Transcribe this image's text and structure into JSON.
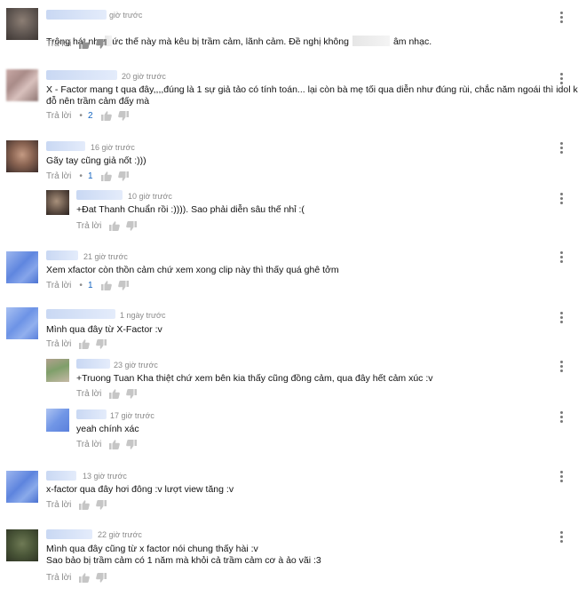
{
  "ui": {
    "reply_label": "Trả lời",
    "dot": "•",
    "like_icon": "thumbs-up-icon",
    "dislike_icon": "thumbs-down-icon",
    "menu_icon": "more-vert-icon"
  },
  "comments": [
    {
      "time": "giờ trước",
      "text_before": "Trông hát như",
      "text_middle": "ức thế này mà kêu bị trầm cảm, lãnh cảm. Đề nghị không",
      "text_after": "âm nhạc."
    },
    {
      "time": "20 giờ trước",
      "text": "X - Factor mang t qua đây,,,,đúng là 1 sự giả tảo có tính toán... lại còn bà mẹ tối qua diễn như đúng rùi, chắc năm ngoái thì idol k\nđỗ nên trầm cảm đấy mà",
      "reply_count": "2"
    },
    {
      "time": "16 giờ trước",
      "text": "Gãy tay cũng giả nốt :)))",
      "reply_count": "1"
    },
    {
      "time": "10 giờ trước",
      "text": "+Đat Thanh Chuẩn rồi :)))). Sao phải diễn sâu thế nhỉ :("
    },
    {
      "time": "21 giờ trước",
      "text": "Xem xfactor còn thồn cảm chứ xem xong clip này thì thấy quá ghê tởm",
      "reply_count": "1"
    },
    {
      "time": "1 ngày trước",
      "text": "Mình qua đây từ X-Factor :v"
    },
    {
      "time": "23 giờ trước",
      "text": "+Truong Tuan Kha thiệt chứ xem bên kia thấy cũng đồng cảm, qua đây hết cảm xúc :v"
    },
    {
      "time": "17 giờ trước",
      "text": "yeah chính xác"
    },
    {
      "time": "13 giờ trước",
      "text": "x-factor qua đây hơi đông :v lượt view tăng :v"
    },
    {
      "time": "22 giờ trước",
      "text": "Mình qua đây cũng từ x factor nói chung thấy hài :v\nSao bảo bị trầm cảm có 1 năm mà khỏi cả trầm cảm cơ à ảo vãi :3"
    }
  ],
  "colors": {
    "accent": "#1565c0",
    "meta": "#8a8a8a"
  }
}
